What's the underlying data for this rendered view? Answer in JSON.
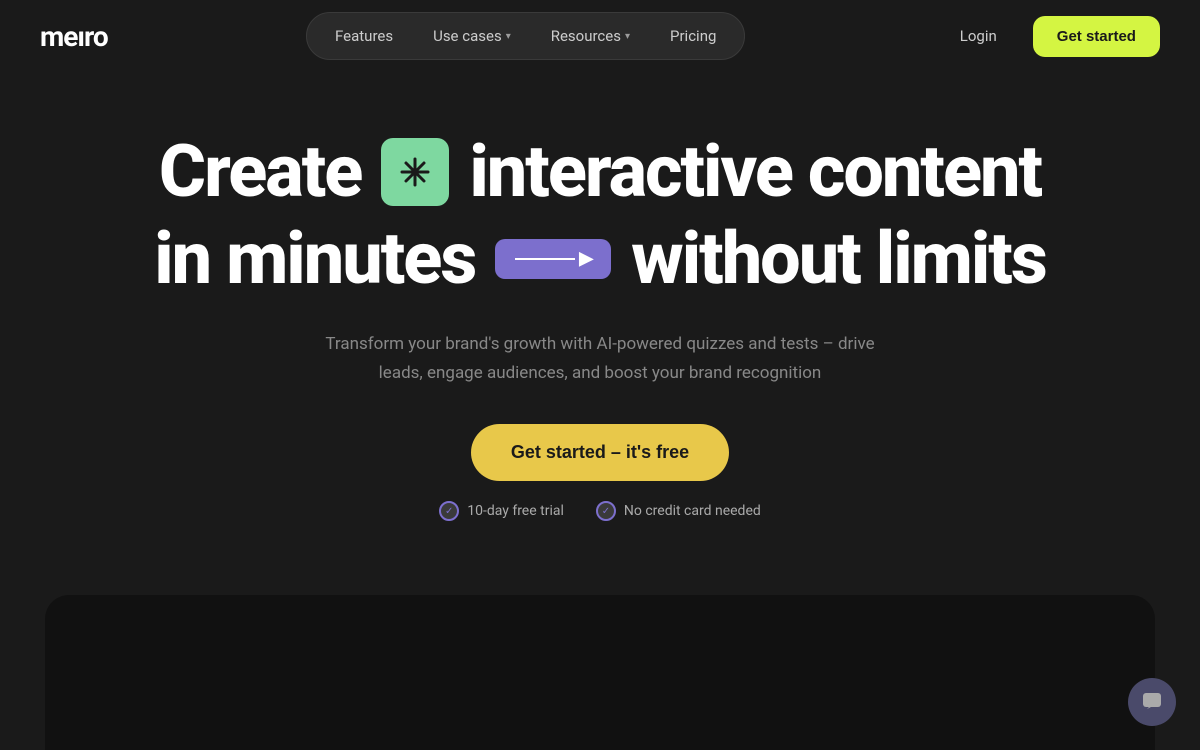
{
  "brand": {
    "logo": "meıro"
  },
  "nav": {
    "items": [
      {
        "label": "Features",
        "hasDropdown": false
      },
      {
        "label": "Use cases",
        "hasDropdown": true
      },
      {
        "label": "Resources",
        "hasDropdown": true
      },
      {
        "label": "Pricing",
        "hasDropdown": false
      }
    ],
    "login_label": "Login",
    "get_started_label": "Get started"
  },
  "hero": {
    "line1_start": "Create",
    "icon1_symbol": "✦",
    "line1_end": "interactive content",
    "line2_start": "in minutes",
    "line2_end": "without limits",
    "subtitle": "Transform your brand's growth with AI-powered quizzes and tests – drive leads, engage audiences, and boost your brand recognition",
    "cta_label": "Get started – it's free",
    "trust_items": [
      {
        "label": "10-day free trial"
      },
      {
        "label": "No credit card needed"
      }
    ]
  },
  "chat_icon": "💬",
  "colors": {
    "accent_yellow": "#d4f542",
    "accent_cta": "#e8c84a",
    "accent_purple": "#7c6fcd",
    "accent_green": "#7ed8a0",
    "bg_dark": "#1a1a1a",
    "bg_darker": "#111111"
  }
}
